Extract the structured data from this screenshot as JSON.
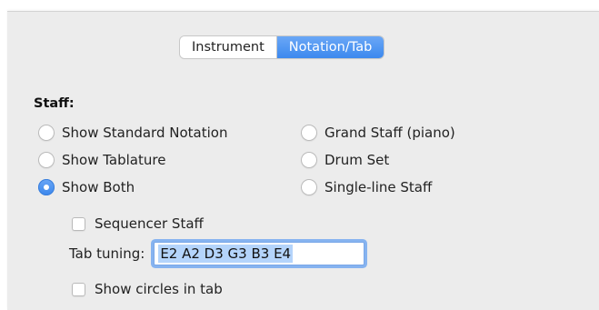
{
  "tabs": {
    "instrument_label": "Instrument",
    "notation_label": "Notation/Tab",
    "active": "Notation/Tab"
  },
  "staff": {
    "section_label": "Staff:",
    "options_left": [
      {
        "label": "Show Standard Notation",
        "checked": false
      },
      {
        "label": "Show Tablature",
        "checked": false
      },
      {
        "label": "Show Both",
        "checked": true
      }
    ],
    "options_right": [
      {
        "label": "Grand Staff (piano)",
        "checked": false
      },
      {
        "label": "Drum Set",
        "checked": false
      },
      {
        "label": "Single-line Staff",
        "checked": false
      }
    ]
  },
  "sequencer_staff": {
    "label": "Sequencer Staff",
    "checked": false
  },
  "tab_tuning": {
    "label": "Tab tuning:",
    "value": "E2 A2 D3 G3 B3 E4"
  },
  "show_circles": {
    "label": "Show circles in tab",
    "checked": false
  },
  "colors": {
    "accent": "#3c89ee",
    "panel_bg": "#ececec",
    "selection": "#b4d4fb"
  }
}
